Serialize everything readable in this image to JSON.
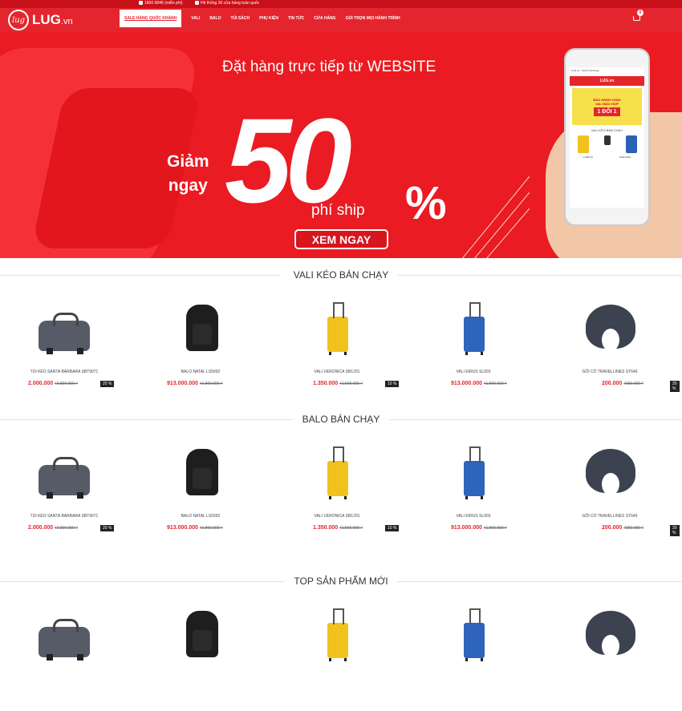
{
  "top": {
    "hotline": "1800 6846 (miễn phí)",
    "stores": "Hệ thống 36 cửa hàng toàn quốc"
  },
  "header": {
    "logo": "LUG",
    "logo_suffix": ".vn",
    "logo_mark": "lug",
    "nav": [
      "SALE HÀNG QUỐC KHÁNH",
      "VALI",
      "BALO",
      "TÚI SÁCH",
      "PHỤ KIỆN",
      "TIN TỨC",
      "CỬA HÀNG",
      "GÓI TRỌN MỌI HÀNH TRÌNH"
    ],
    "cart_count": "0",
    "cart_icon": "cart-icon"
  },
  "banner": {
    "headline": "Đặt hàng trực tiếp từ WEBSITE",
    "giam": "Giảm",
    "ngay": "ngay",
    "number": "50",
    "percent": "%",
    "ship": "phí ship",
    "cta": "XEM NGAY",
    "phone": {
      "url": "LUG.vn - Chuỗi cửa hàng...",
      "bar": "LUG.vn",
      "promo_top": "BẢO HÀNH VÀNG",
      "promo_mid": "VALI BẢO HỢP",
      "promo_big": "1 ĐỔI 1",
      "section": "VALI KÉO BÁN CHẠY",
      "labels": [
        "LUSETTI",
        "SANTA BA"
      ]
    }
  },
  "sections": [
    {
      "title": "VALI KÉO BÁN CHẠY",
      "products": [
        {
          "name": "TÚI KÉO SANTA BARBARA SBT9071",
          "price": "2.000.000",
          "old": "₫2.800.000 ₫",
          "discount": "20 %"
        },
        {
          "name": "BALO NATAL LS5092",
          "price": "913.000.000",
          "old": "₫1.800.000 ₫",
          "discount": ""
        },
        {
          "name": "VALI VERONICA SB1201",
          "price": "1.350.000",
          "old": "₫1.500.000 ₫",
          "discount": "10 %"
        },
        {
          "name": "VALI EIRUS SL003",
          "price": "913.000.000",
          "old": "₫1.800.000 ₫",
          "discount": ""
        },
        {
          "name": "GỐI CỔ TRAVELLINES ST646",
          "price": "200.000",
          "old": "₫250.000 ₫",
          "discount": "20 %"
        }
      ]
    },
    {
      "title": "BALO BÁN CHẠY",
      "products": [
        {
          "name": "TÚI KÉO SANTA BARBARA SBT9071",
          "price": "2.000.000",
          "old": "₫2.800.000 ₫",
          "discount": "20 %"
        },
        {
          "name": "BALO NATAL LS5092",
          "price": "913.000.000",
          "old": "₫1.800.000 ₫",
          "discount": ""
        },
        {
          "name": "VALI VERONICA SB1201",
          "price": "1.350.000",
          "old": "₫1.500.000 ₫",
          "discount": "10 %"
        },
        {
          "name": "VALI EIRUS SL003",
          "price": "913.000.000",
          "old": "₫1.800.000 ₫",
          "discount": ""
        },
        {
          "name": "GỐI CỔ TRAVELLINES ST646",
          "price": "200.000",
          "old": "₫250.000 ₫",
          "discount": "20 %"
        }
      ]
    },
    {
      "title": "TOP SẢN PHẨM MỚI",
      "products": [
        {
          "name": "",
          "price": "",
          "old": "",
          "discount": ""
        },
        {
          "name": "",
          "price": "",
          "old": "",
          "discount": ""
        },
        {
          "name": "",
          "price": "",
          "old": "",
          "discount": ""
        },
        {
          "name": "",
          "price": "",
          "old": "",
          "discount": ""
        },
        {
          "name": "",
          "price": "",
          "old": "",
          "discount": ""
        }
      ]
    }
  ],
  "colors": {
    "brand_red": "#e5252d",
    "dark_red": "#c8101a",
    "price_red": "#e5252d"
  }
}
